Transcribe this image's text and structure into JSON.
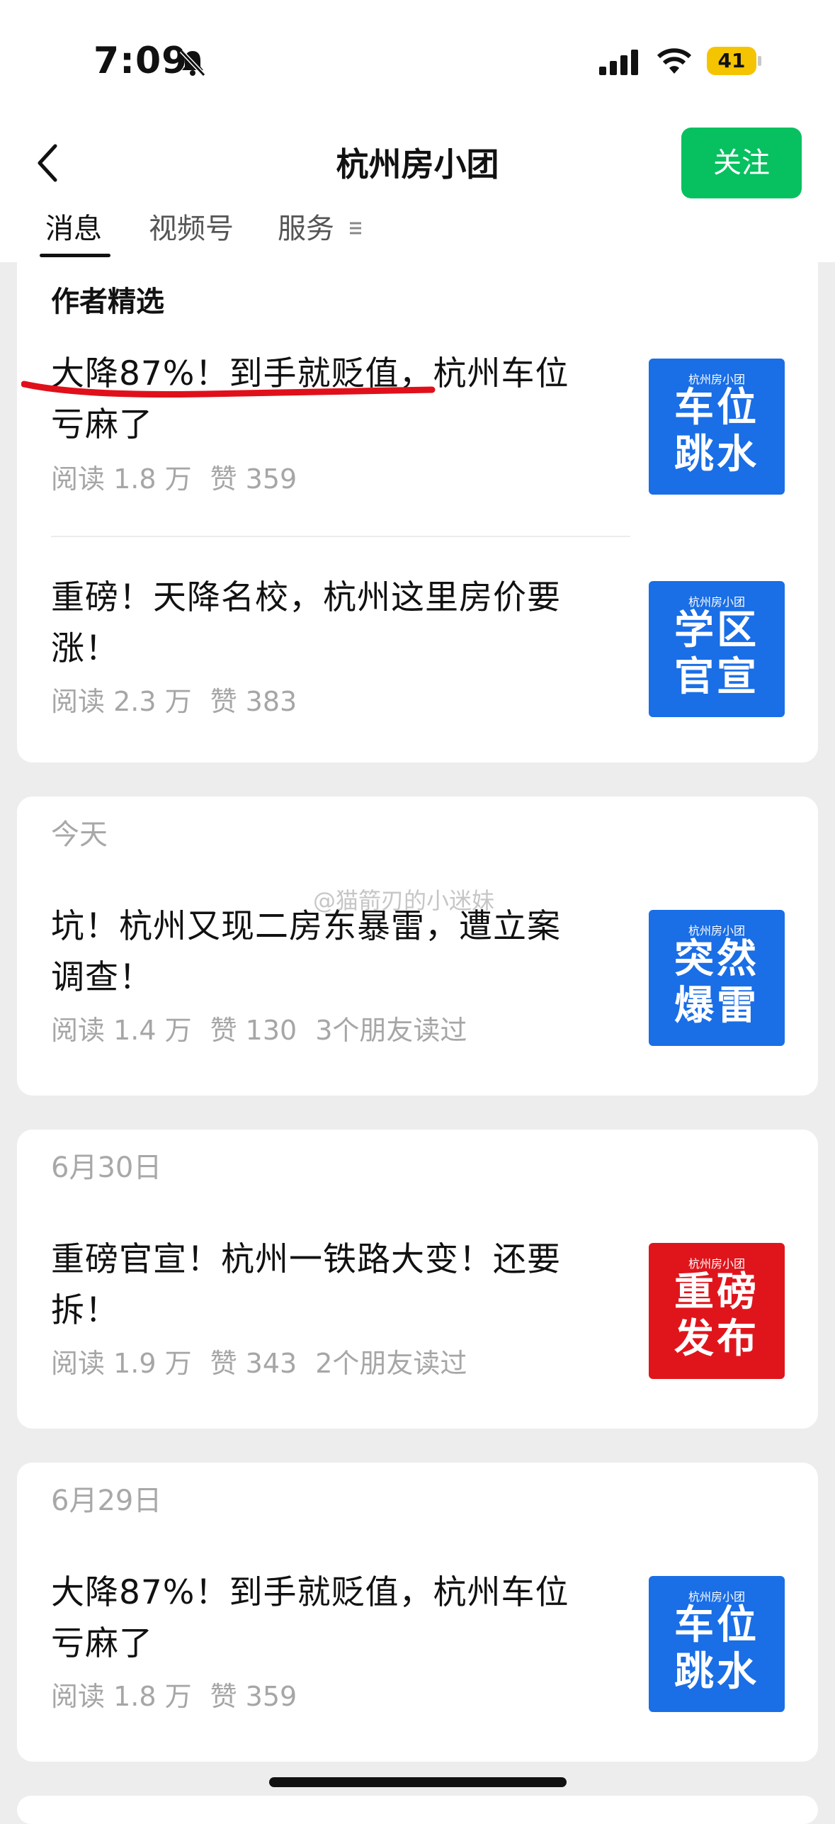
{
  "status_bar": {
    "time": "7:09",
    "battery": "41"
  },
  "header": {
    "title": "杭州房小团",
    "follow_label": "关注"
  },
  "tabs": [
    {
      "label": "消息"
    },
    {
      "label": "视频号"
    },
    {
      "label": "服务"
    }
  ],
  "featured": {
    "section_title": "作者精选",
    "articles": [
      {
        "title_line1": "大降87%！到手就贬值，杭州车位",
        "title_line2": "亏麻了",
        "reads": "阅读 1.8 万",
        "likes": "赞 359",
        "thumb": {
          "brand": "杭州房小团",
          "line1": "车位",
          "line2": "跳水",
          "color": "#1a6ee6"
        }
      },
      {
        "title_line1": "重磅！天降名校，杭州这里房价要",
        "title_line2": "涨！",
        "reads": "阅读 2.3 万",
        "likes": "赞 383",
        "thumb": {
          "brand": "杭州房小团",
          "line1": "学区",
          "line2": "官宣",
          "color": "#1a6ee6"
        }
      }
    ]
  },
  "feed": [
    {
      "date": "今天",
      "title_line1": "坑！杭州又现二房东暴雷，遭立案",
      "title_line2": "调查！",
      "reads": "阅读 1.4 万",
      "likes": "赞 130",
      "friends": "3个朋友读过",
      "thumb": {
        "brand": "杭州房小团",
        "line1": "突然",
        "line2": "爆雷",
        "color": "#1a6ee6"
      }
    },
    {
      "date": "6月30日",
      "title_line1": "重磅官宣！杭州一铁路大变！还要",
      "title_line2": "拆！",
      "reads": "阅读 1.9 万",
      "likes": "赞 343",
      "friends": "2个朋友读过",
      "thumb": {
        "brand": "杭州房小团",
        "line1": "重磅",
        "line2": "发布",
        "color": "#e0151c"
      }
    },
    {
      "date": "6月29日",
      "title_line1": "大降87%！到手就贬值，杭州车位",
      "title_line2": "亏麻了",
      "reads": "阅读 1.8 万",
      "likes": "赞 359",
      "thumb": {
        "brand": "杭州房小团",
        "line1": "车位",
        "line2": "跳水",
        "color": "#1a6ee6"
      }
    }
  ],
  "watermark": "@猫箭刃的小迷妹",
  "colors": {
    "accent_green": "#07c160",
    "thumb_blue": "#1a6ee6",
    "thumb_red": "#e0151c",
    "annotation_red": "#e0101a"
  },
  "icons": [
    "bell-slash-icon",
    "signal-icon",
    "wifi-icon",
    "battery-icon",
    "back-chevron-icon",
    "menu-lines-icon"
  ]
}
